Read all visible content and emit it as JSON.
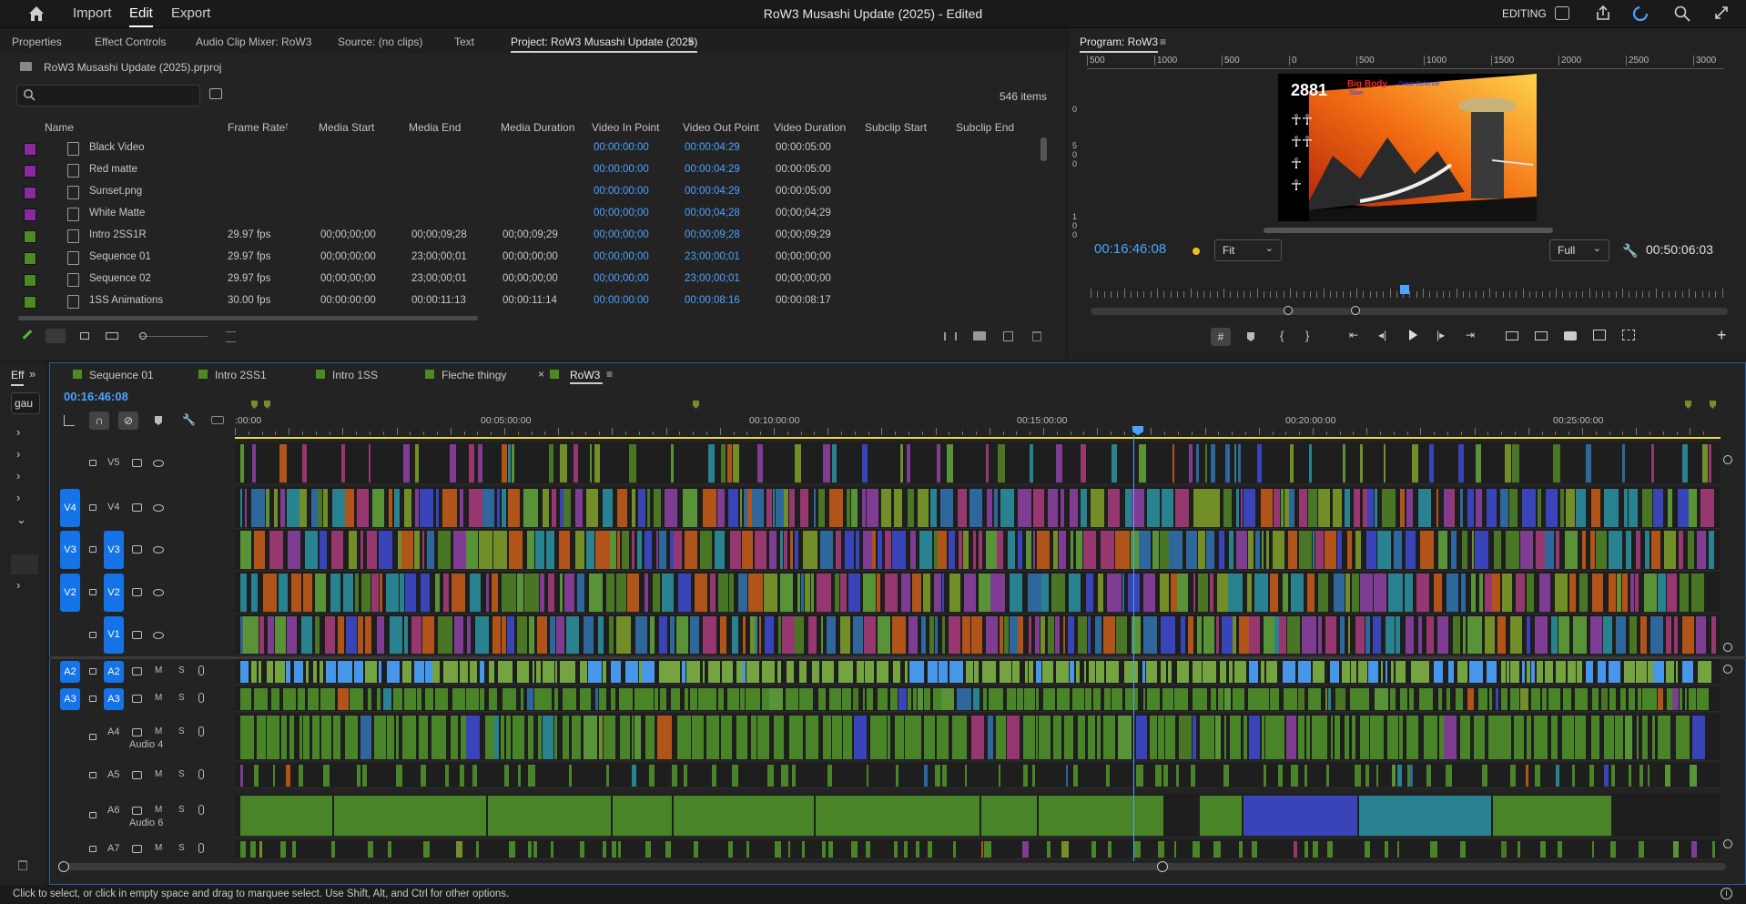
{
  "app": {
    "menus": [
      "Import",
      "Edit",
      "Export"
    ],
    "active_menu": "Edit",
    "title": "RoW3 Musashi Update (2025) - Edited",
    "workspace": "EDITING"
  },
  "upper_tabs": [
    "Properties",
    "Effect Controls",
    "Audio Clip Mixer: RoW3",
    "Source: (no clips)",
    "Text",
    "Project: RoW3 Musashi Update (2025)"
  ],
  "project": {
    "file": "RoW3 Musashi Update (2025).prproj",
    "search_placeholder": "",
    "item_count": "546 items",
    "columns": [
      "Name",
      "Frame Rate",
      "Media Start",
      "Media End",
      "Media Duration",
      "Video In Point",
      "Video Out Point",
      "Video Duration",
      "Subclip Start",
      "Subclip End"
    ],
    "sort_indicator": "↑",
    "rows": [
      {
        "swatch": "#8a2aa0",
        "name": "Black Video",
        "fr": "",
        "ms": "",
        "me": "",
        "md": "",
        "vin": "00:00:00:00",
        "vout": "00:00:04:29",
        "vd": "00:00:05:00"
      },
      {
        "swatch": "#8a2aa0",
        "name": "Red matte",
        "fr": "",
        "ms": "",
        "me": "",
        "md": "",
        "vin": "00:00:00:00",
        "vout": "00:00:04:29",
        "vd": "00:00:05:00"
      },
      {
        "swatch": "#8a2aa0",
        "name": "Sunset.png",
        "fr": "",
        "ms": "",
        "me": "",
        "md": "",
        "vin": "00:00:00:00",
        "vout": "00:00:04:29",
        "vd": "00:00:05:00"
      },
      {
        "swatch": "#8a2aa0",
        "name": "White Matte",
        "fr": "",
        "ms": "",
        "me": "",
        "md": "",
        "vin": "00;00;00;00",
        "vout": "00;00;04;28",
        "vd": "00;00;04;29"
      },
      {
        "swatch": "#4e8a22",
        "name": "Intro 2SS1R",
        "fr": "29.97 fps",
        "ms": "00;00;00;00",
        "me": "00;00;09;28",
        "md": "00;00;09;29",
        "vin": "00;00;00;00",
        "vout": "00;00;09;28",
        "vd": "00;00;09;29"
      },
      {
        "swatch": "#4e8a22",
        "name": "Sequence 01",
        "fr": "29.97 fps",
        "ms": "00;00;00;00",
        "me": "23;00;00;01",
        "md": "00;00;00;00",
        "vin": "00;00;00;00",
        "vout": "23;00;00;01",
        "vd": "00;00;00;00"
      },
      {
        "swatch": "#4e8a22",
        "name": "Sequence 02",
        "fr": "29.97 fps",
        "ms": "00;00;00;00",
        "me": "23;00;00;01",
        "md": "00;00;00;00",
        "vin": "00;00;00;00",
        "vout": "23;00;00;01",
        "vd": "00;00;00;00"
      },
      {
        "swatch": "#4e8a22",
        "name": "1SS Animations",
        "fr": "30.00 fps",
        "ms": "00:00:00:00",
        "me": "00:00:11:13",
        "md": "00:00:11:14",
        "vin": "00:00:00:00",
        "vout": "00:00:08:16",
        "vd": "00:00:08:17"
      }
    ]
  },
  "program": {
    "tab": "Program: RoW3",
    "ruler": [
      "500",
      "1000",
      "500",
      "0",
      "500",
      "1000",
      "1500",
      "2000",
      "2500",
      "3000"
    ],
    "timecode": "00:16:46:08",
    "fit": "Fit",
    "quality": "Full",
    "duration": "00:50:06:03",
    "preview_text": {
      "score": "2881",
      "title": "Big Body",
      "subtitle": "Great Defense",
      "small": "Slow"
    }
  },
  "timeline": {
    "left_tab": "Eff",
    "search_value": "gau",
    "seq_tabs": [
      "Sequence 01",
      "Intro 2SS1",
      "Intro 1SS",
      "Fleche thingy",
      "RoW3"
    ],
    "active_seq": "RoW3",
    "timecode": "00:16:46:08",
    "ruler_labels": [
      ":00:00",
      "00:05:00:00",
      "00:10:00:00",
      "00:15:00:00",
      "00:20:00:00",
      "00:25:00:00"
    ],
    "video_tracks": [
      {
        "id": "V5",
        "src": "",
        "tgt": ""
      },
      {
        "id": "V4",
        "src": "V4",
        "tgt": ""
      },
      {
        "id": "V3",
        "src": "V3",
        "tgt": "V3"
      },
      {
        "id": "V2",
        "src": "V2",
        "tgt": "V2"
      },
      {
        "id": "V1",
        "src": "",
        "tgt": "V1"
      }
    ],
    "audio_tracks": [
      {
        "id": "A2",
        "src": "A2",
        "tgt": "A2",
        "name": ""
      },
      {
        "id": "A3",
        "src": "A3",
        "tgt": "A3",
        "name": ""
      },
      {
        "id": "A4",
        "src": "",
        "tgt": "",
        "name": "Audio 4"
      },
      {
        "id": "A5",
        "src": "",
        "tgt": "",
        "name": ""
      },
      {
        "id": "A6",
        "src": "",
        "tgt": "",
        "name": "Audio 6"
      },
      {
        "id": "A7",
        "src": "",
        "tgt": "",
        "name": ""
      }
    ],
    "m_label": "M",
    "s_label": "S"
  },
  "status": "Click to select, or click in empty space and drag to marquee select. Use Shift, Alt, and Ctrl for other options.",
  "colors": {
    "accent": "#1473e6",
    "timecode_blue": "#4aa3ff",
    "playhead": "#4aa3ff",
    "audio_green": "#4f8f2a"
  }
}
